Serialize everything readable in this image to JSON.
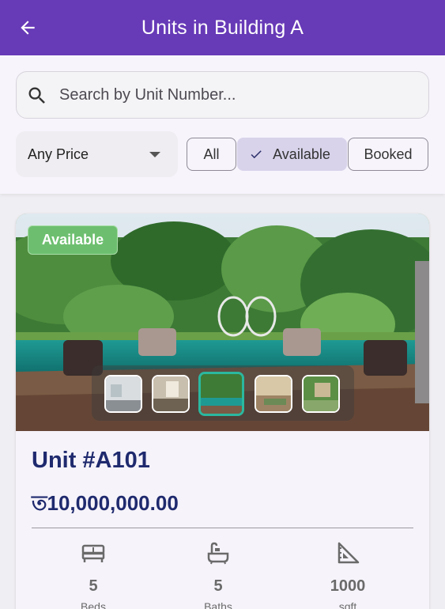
{
  "appbar": {
    "title": "Units in Building A"
  },
  "search": {
    "placeholder": "Search by Unit Number..."
  },
  "filters": {
    "price": {
      "selected": "Any Price"
    },
    "chips": [
      {
        "label": "All",
        "selected": false
      },
      {
        "label": "Available",
        "selected": true
      },
      {
        "label": "Booked",
        "selected": false
      }
    ]
  },
  "card": {
    "status_badge": "Available",
    "title": "Unit #A101",
    "price": "ত10,000,000.00",
    "thumbnails": 5,
    "active_thumbnail": 3,
    "stats": [
      {
        "icon": "bed-icon",
        "value": "5",
        "label": "Beds"
      },
      {
        "icon": "bathtub-icon",
        "value": "5",
        "label": "Baths"
      },
      {
        "icon": "ruler-square-icon",
        "value": "1000",
        "label": "sqft"
      }
    ]
  },
  "colors": {
    "appbar": "#673ab7",
    "accent_text": "#1f2a6e",
    "badge": "#6dbf6f",
    "chip_selected": "#d8d3ea"
  }
}
